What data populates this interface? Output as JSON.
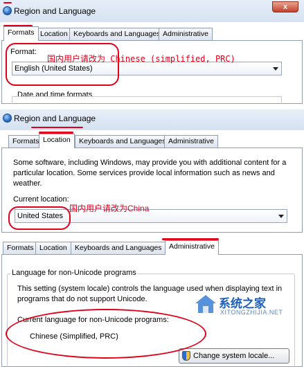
{
  "panel1": {
    "title": "Region and Language",
    "close_label": "x",
    "tabs": [
      "Formats",
      "Location",
      "Keyboards and Languages",
      "Administrative"
    ],
    "format_label": "Format:",
    "format_value": "English (United States)",
    "annotation": "国内用户请改为 Chinese (simplified, PRC)",
    "date_time_label": "Date and time formats"
  },
  "panel2": {
    "title": "Region and Language",
    "tabs": [
      "Formats",
      "Location",
      "Keyboards and Languages",
      "Administrative"
    ],
    "description": "Some software, including Windows, may provide you with additional content for a particular location. Some services provide local information such as news and weather.",
    "current_location_label": "Current location:",
    "current_location_value": "United States",
    "annotation": "国内用户请改为China"
  },
  "panel3": {
    "tabs": [
      "Formats",
      "Location",
      "Keyboards and Languages",
      "Administrative"
    ],
    "group_title": "Language for non-Unicode programs",
    "description": "This setting (system locale) controls the language used when displaying text in programs that do not support Unicode.",
    "current_label": "Current language for non-Unicode programs:",
    "current_value": "Chinese (Simplified, PRC)",
    "change_button": "Change system locale...",
    "watermark_name": "系统之家",
    "watermark_url": "XITONGZHIJIA.NET"
  },
  "colors": {
    "annotation": "#e0001b",
    "titlebar": "#dbe6f4"
  }
}
